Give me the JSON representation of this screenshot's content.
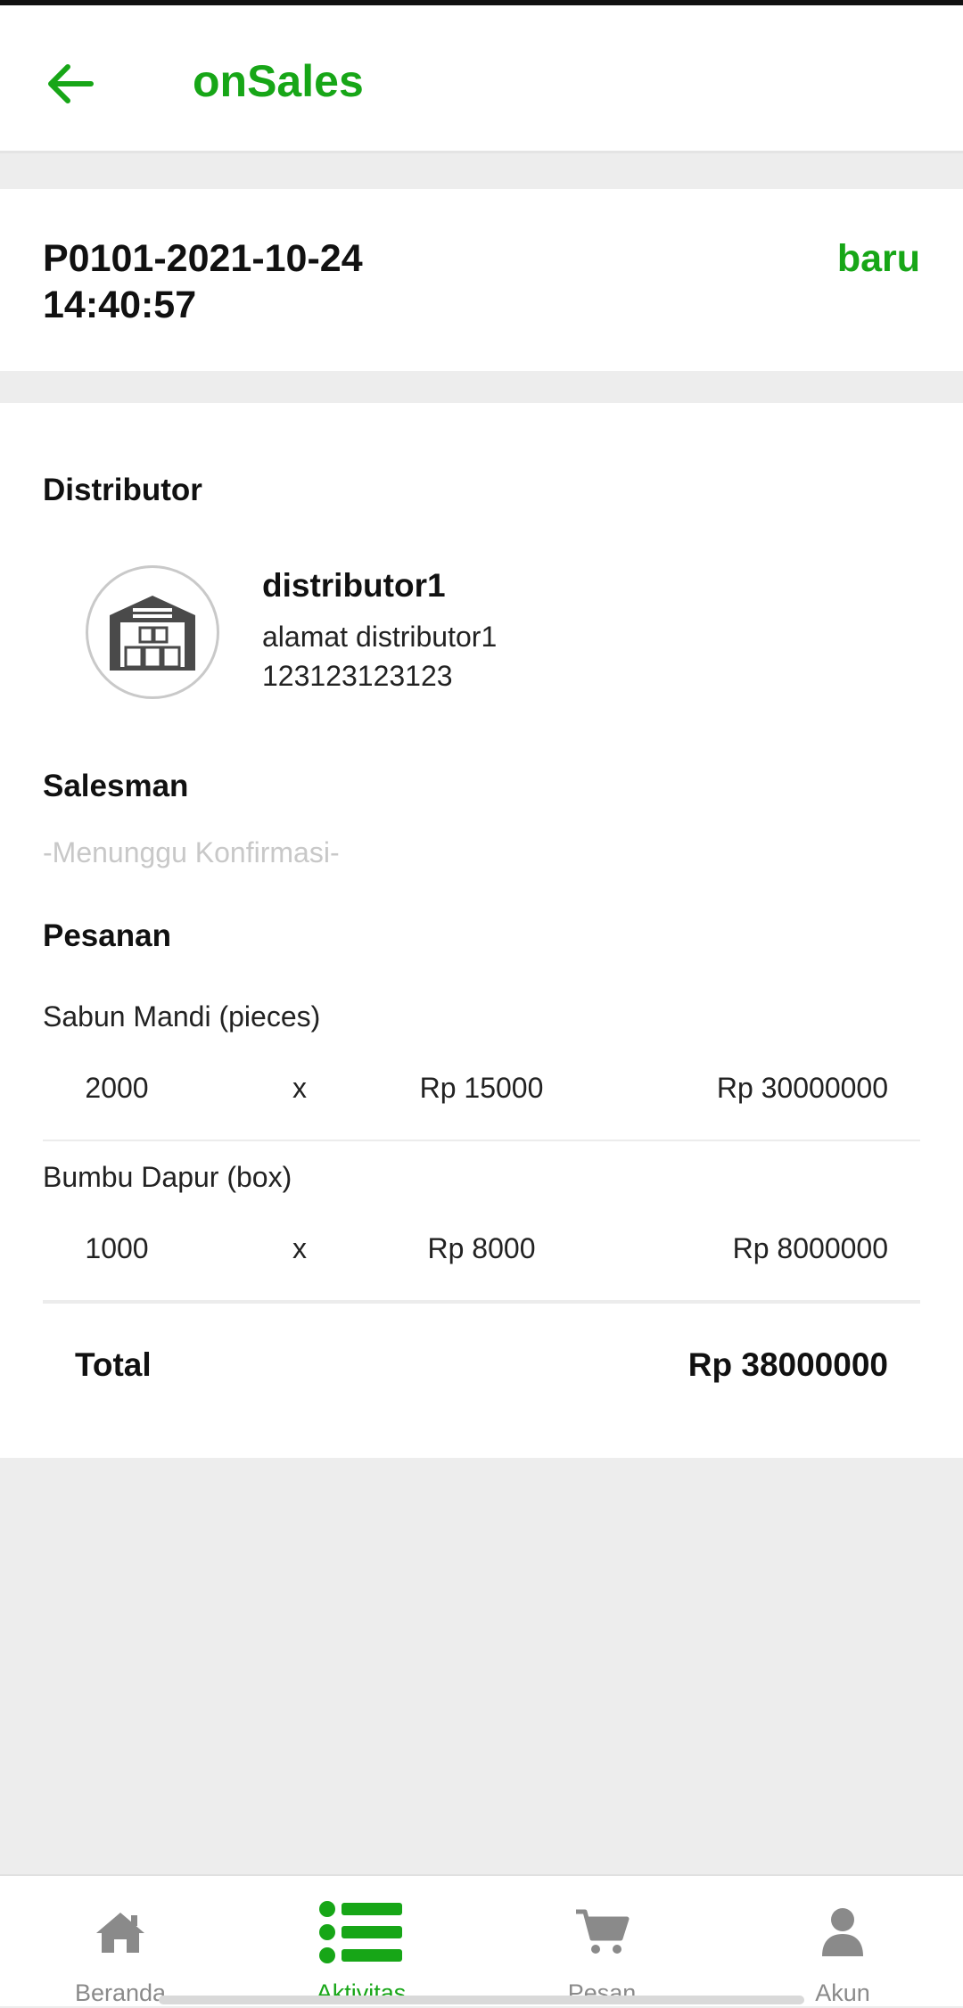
{
  "app": {
    "title": "onSales",
    "accent_color": "#17a617"
  },
  "order": {
    "id_line1": "P0101-2021-10-24",
    "id_line2": "14:40:57",
    "status": "baru"
  },
  "distributor": {
    "section_title": "Distributor",
    "name": "distributor1",
    "address": "alamat distributor1",
    "phone": "123123123123",
    "icon": "warehouse-icon"
  },
  "salesman": {
    "section_title": "Salesman",
    "status_text": "-Menunggu Konfirmasi-"
  },
  "pesanan": {
    "section_title": "Pesanan",
    "items": [
      {
        "name": "Sabun Mandi (pieces)",
        "qty": "2000",
        "times": "x",
        "price": "Rp 15000",
        "subtotal": "Rp 30000000"
      },
      {
        "name": "Bumbu Dapur (box)",
        "qty": "1000",
        "times": "x",
        "price": "Rp 8000",
        "subtotal": "Rp 8000000"
      }
    ],
    "total_label": "Total",
    "total_value": "Rp 38000000"
  },
  "bottom_nav": {
    "items": [
      {
        "label": "Beranda",
        "icon": "home-icon",
        "active": false
      },
      {
        "label": "Aktivitas",
        "icon": "list-icon",
        "active": true
      },
      {
        "label": "Pesan",
        "icon": "cart-icon",
        "active": false
      },
      {
        "label": "Akun",
        "icon": "user-icon",
        "active": false
      }
    ]
  }
}
